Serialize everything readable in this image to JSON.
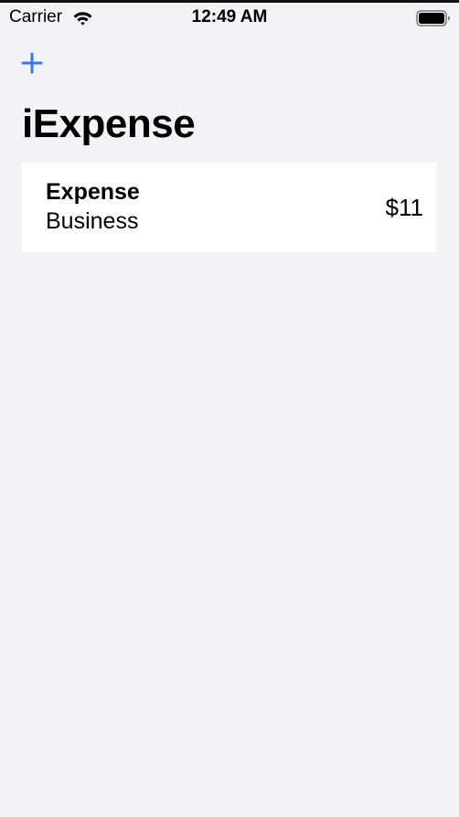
{
  "status_bar": {
    "carrier": "Carrier",
    "time": "12:49 AM",
    "icons": [
      "wifi-icon",
      "battery-icon"
    ]
  },
  "nav": {
    "add_icon": "plus-icon",
    "title": "iExpense"
  },
  "expenses": [
    {
      "name": "Expense",
      "type": "Business",
      "amount": "$11"
    }
  ],
  "colors": {
    "accent": "#3478f6",
    "background": "#f2f2f7",
    "row_background": "#ffffff",
    "text": "#000000"
  }
}
